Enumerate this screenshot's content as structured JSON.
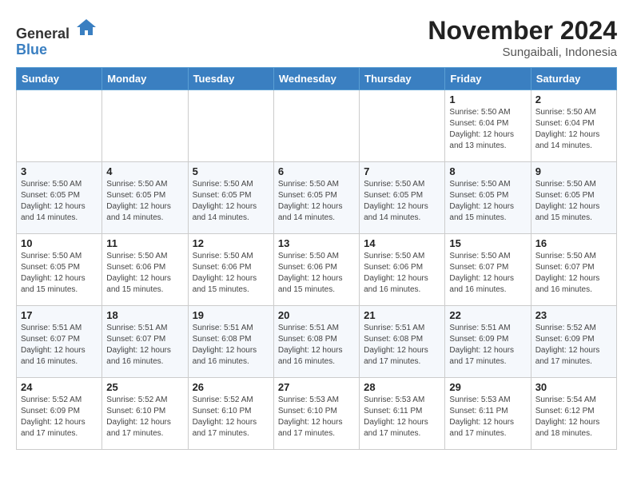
{
  "header": {
    "logo_line1": "General",
    "logo_line2": "Blue",
    "month_year": "November 2024",
    "location": "Sungaibali, Indonesia"
  },
  "days_of_week": [
    "Sunday",
    "Monday",
    "Tuesday",
    "Wednesday",
    "Thursday",
    "Friday",
    "Saturday"
  ],
  "weeks": [
    [
      {
        "day": "",
        "info": ""
      },
      {
        "day": "",
        "info": ""
      },
      {
        "day": "",
        "info": ""
      },
      {
        "day": "",
        "info": ""
      },
      {
        "day": "",
        "info": ""
      },
      {
        "day": "1",
        "info": "Sunrise: 5:50 AM\nSunset: 6:04 PM\nDaylight: 12 hours\nand 13 minutes."
      },
      {
        "day": "2",
        "info": "Sunrise: 5:50 AM\nSunset: 6:04 PM\nDaylight: 12 hours\nand 14 minutes."
      }
    ],
    [
      {
        "day": "3",
        "info": "Sunrise: 5:50 AM\nSunset: 6:05 PM\nDaylight: 12 hours\nand 14 minutes."
      },
      {
        "day": "4",
        "info": "Sunrise: 5:50 AM\nSunset: 6:05 PM\nDaylight: 12 hours\nand 14 minutes."
      },
      {
        "day": "5",
        "info": "Sunrise: 5:50 AM\nSunset: 6:05 PM\nDaylight: 12 hours\nand 14 minutes."
      },
      {
        "day": "6",
        "info": "Sunrise: 5:50 AM\nSunset: 6:05 PM\nDaylight: 12 hours\nand 14 minutes."
      },
      {
        "day": "7",
        "info": "Sunrise: 5:50 AM\nSunset: 6:05 PM\nDaylight: 12 hours\nand 14 minutes."
      },
      {
        "day": "8",
        "info": "Sunrise: 5:50 AM\nSunset: 6:05 PM\nDaylight: 12 hours\nand 15 minutes."
      },
      {
        "day": "9",
        "info": "Sunrise: 5:50 AM\nSunset: 6:05 PM\nDaylight: 12 hours\nand 15 minutes."
      }
    ],
    [
      {
        "day": "10",
        "info": "Sunrise: 5:50 AM\nSunset: 6:05 PM\nDaylight: 12 hours\nand 15 minutes."
      },
      {
        "day": "11",
        "info": "Sunrise: 5:50 AM\nSunset: 6:06 PM\nDaylight: 12 hours\nand 15 minutes."
      },
      {
        "day": "12",
        "info": "Sunrise: 5:50 AM\nSunset: 6:06 PM\nDaylight: 12 hours\nand 15 minutes."
      },
      {
        "day": "13",
        "info": "Sunrise: 5:50 AM\nSunset: 6:06 PM\nDaylight: 12 hours\nand 15 minutes."
      },
      {
        "day": "14",
        "info": "Sunrise: 5:50 AM\nSunset: 6:06 PM\nDaylight: 12 hours\nand 16 minutes."
      },
      {
        "day": "15",
        "info": "Sunrise: 5:50 AM\nSunset: 6:07 PM\nDaylight: 12 hours\nand 16 minutes."
      },
      {
        "day": "16",
        "info": "Sunrise: 5:50 AM\nSunset: 6:07 PM\nDaylight: 12 hours\nand 16 minutes."
      }
    ],
    [
      {
        "day": "17",
        "info": "Sunrise: 5:51 AM\nSunset: 6:07 PM\nDaylight: 12 hours\nand 16 minutes."
      },
      {
        "day": "18",
        "info": "Sunrise: 5:51 AM\nSunset: 6:07 PM\nDaylight: 12 hours\nand 16 minutes."
      },
      {
        "day": "19",
        "info": "Sunrise: 5:51 AM\nSunset: 6:08 PM\nDaylight: 12 hours\nand 16 minutes."
      },
      {
        "day": "20",
        "info": "Sunrise: 5:51 AM\nSunset: 6:08 PM\nDaylight: 12 hours\nand 16 minutes."
      },
      {
        "day": "21",
        "info": "Sunrise: 5:51 AM\nSunset: 6:08 PM\nDaylight: 12 hours\nand 17 minutes."
      },
      {
        "day": "22",
        "info": "Sunrise: 5:51 AM\nSunset: 6:09 PM\nDaylight: 12 hours\nand 17 minutes."
      },
      {
        "day": "23",
        "info": "Sunrise: 5:52 AM\nSunset: 6:09 PM\nDaylight: 12 hours\nand 17 minutes."
      }
    ],
    [
      {
        "day": "24",
        "info": "Sunrise: 5:52 AM\nSunset: 6:09 PM\nDaylight: 12 hours\nand 17 minutes."
      },
      {
        "day": "25",
        "info": "Sunrise: 5:52 AM\nSunset: 6:10 PM\nDaylight: 12 hours\nand 17 minutes."
      },
      {
        "day": "26",
        "info": "Sunrise: 5:52 AM\nSunset: 6:10 PM\nDaylight: 12 hours\nand 17 minutes."
      },
      {
        "day": "27",
        "info": "Sunrise: 5:53 AM\nSunset: 6:10 PM\nDaylight: 12 hours\nand 17 minutes."
      },
      {
        "day": "28",
        "info": "Sunrise: 5:53 AM\nSunset: 6:11 PM\nDaylight: 12 hours\nand 17 minutes."
      },
      {
        "day": "29",
        "info": "Sunrise: 5:53 AM\nSunset: 6:11 PM\nDaylight: 12 hours\nand 17 minutes."
      },
      {
        "day": "30",
        "info": "Sunrise: 5:54 AM\nSunset: 6:12 PM\nDaylight: 12 hours\nand 18 minutes."
      }
    ]
  ]
}
